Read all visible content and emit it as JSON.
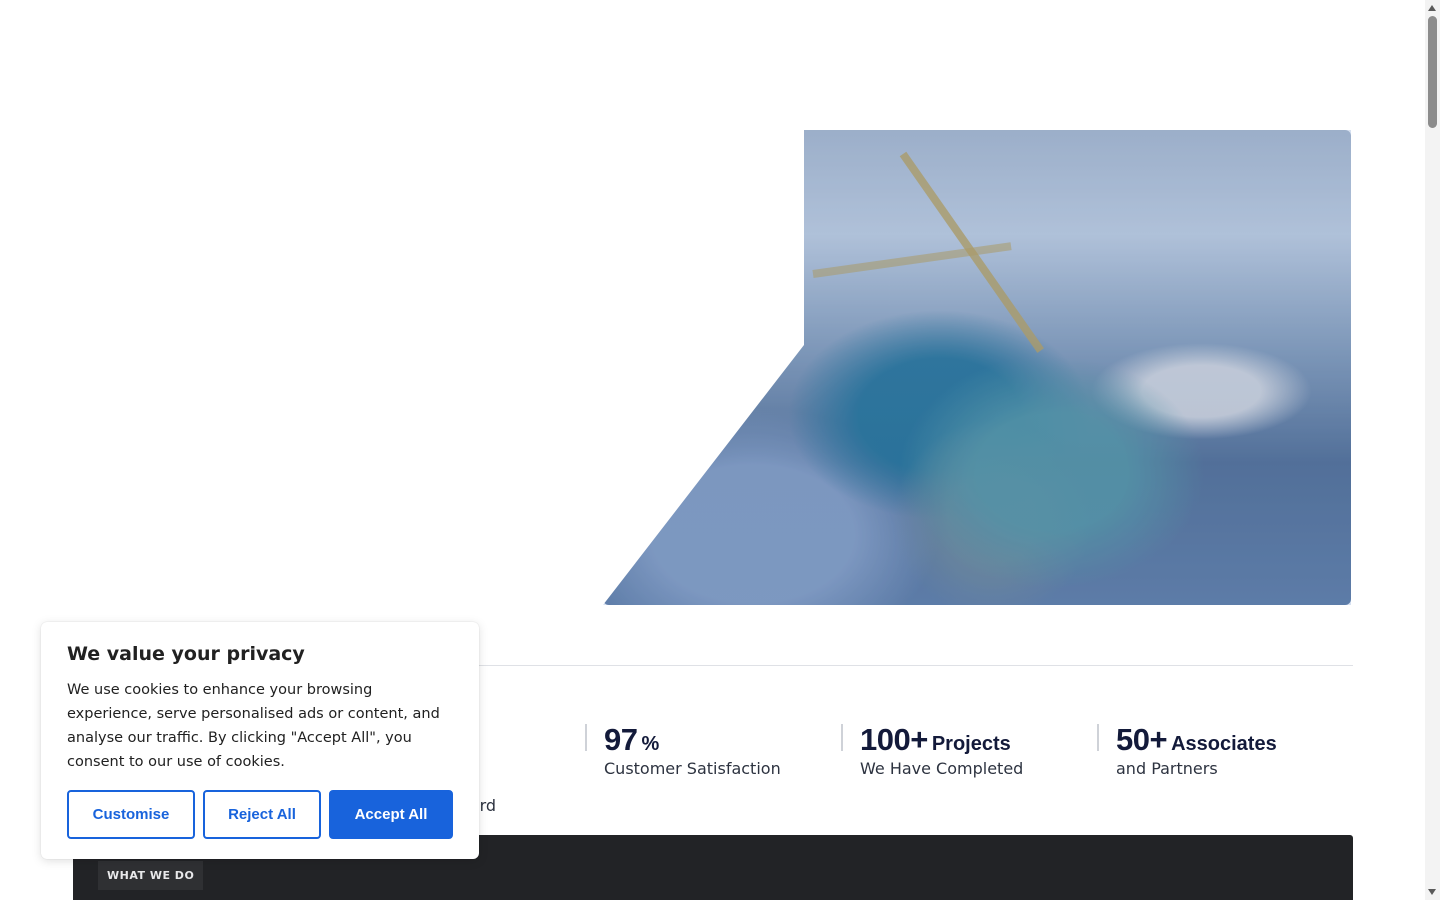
{
  "cookie_banner": {
    "title": "We value your privacy",
    "text": "We use cookies to enhance your browsing experience, serve personalised ads or content, and analyse our traffic. By clicking \"Accept All\", you consent to our use of cookies.",
    "customise_label": "Customise",
    "reject_label": "Reject All",
    "accept_label": "Accept All"
  },
  "stats": [
    {
      "value": "",
      "suffix": "",
      "label": "cord"
    },
    {
      "value": "97",
      "suffix": "%",
      "label": "Customer Satisfaction"
    },
    {
      "value": "100+",
      "suffix": "Projects",
      "label": "We Have Completed"
    },
    {
      "value": "50+",
      "suffix": "Associates",
      "label": "and Partners"
    }
  ],
  "section": {
    "tag": "WHAT WE DO"
  },
  "colors": {
    "accent": "#1863dc",
    "dark_section": "#222326",
    "stat_text": "#131a3a"
  }
}
